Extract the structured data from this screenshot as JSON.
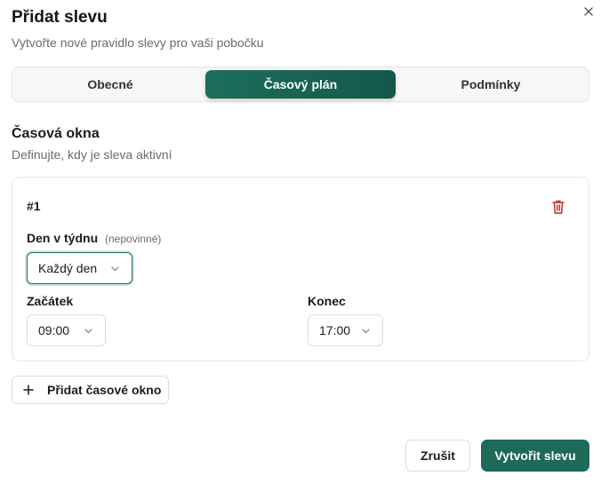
{
  "dialog": {
    "title": "Přidat slevu",
    "subtitle": "Vytvořte nové pravidlo slevy pro vaši pobočku"
  },
  "tabs": [
    {
      "label": "Obecné",
      "active": false
    },
    {
      "label": "Časový plán",
      "active": true
    },
    {
      "label": "Podmínky",
      "active": false
    }
  ],
  "section": {
    "title": "Časová okna",
    "subtitle": "Definujte, kdy je sleva aktivní"
  },
  "time_window": {
    "number": "#1",
    "day_label": "Den v týdnu",
    "day_optional": "(nepovinné)",
    "day_value": "Každý den",
    "start_label": "Začátek",
    "start_value": "09:00",
    "end_label": "Konec",
    "end_value": "17:00"
  },
  "add_window_label": "Přidat časové okno",
  "footer": {
    "cancel_label": "Zrušit",
    "create_label": "Vytvořit slevu"
  },
  "colors": {
    "accent": "#1c6a57",
    "delete": "#c62828"
  },
  "icons": {
    "close": "close-icon",
    "delete": "trash-icon",
    "dropdown": "chevron-down-icon",
    "add": "plus-icon"
  }
}
